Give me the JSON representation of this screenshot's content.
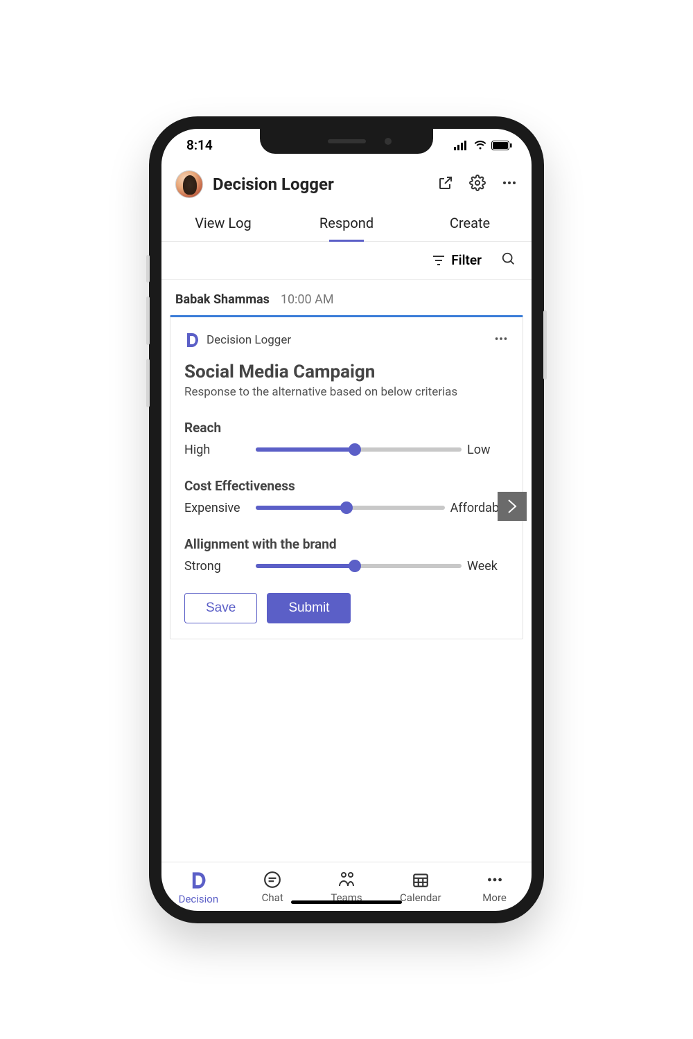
{
  "status": {
    "time": "8:14"
  },
  "header": {
    "title": "Decision Logger"
  },
  "tabs": [
    {
      "label": "View Log",
      "active": false
    },
    {
      "label": "Respond",
      "active": true
    },
    {
      "label": "Create",
      "active": false
    }
  ],
  "filter": {
    "label": "Filter"
  },
  "post": {
    "author": "Babak Shammas",
    "time": "10:00 AM"
  },
  "card": {
    "app_name": "Decision Logger",
    "title": "Social Media Campaign",
    "subtitle": "Response to the alternative based on below criterias",
    "criteria": [
      {
        "name": "Reach",
        "left": "High",
        "right": "Low",
        "value": 48
      },
      {
        "name": "Cost Effectiveness",
        "left": "Expensive",
        "right": "Affordable",
        "value": 48
      },
      {
        "name": "Allignment with the brand",
        "left": "Strong",
        "right": "Week",
        "value": 48
      }
    ],
    "actions": {
      "save": "Save",
      "submit": "Submit"
    }
  },
  "bottom_nav": [
    {
      "label": "Decision",
      "active": true
    },
    {
      "label": "Chat"
    },
    {
      "label": "Teams"
    },
    {
      "label": "Calendar"
    },
    {
      "label": "More"
    }
  ]
}
